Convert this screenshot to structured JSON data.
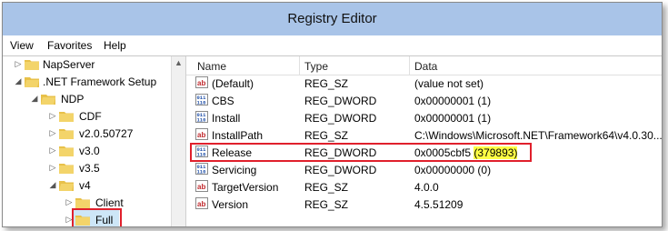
{
  "window": {
    "title": "Registry Editor"
  },
  "menu": [
    "View",
    "Favorites",
    "Help"
  ],
  "tree": [
    {
      "label": "NapServer",
      "expander": "▷"
    },
    {
      "label": ".NET Framework Setup",
      "expander": "◢"
    },
    {
      "label": "NDP",
      "expander": "◢"
    },
    {
      "label": "CDF",
      "expander": "▷"
    },
    {
      "label": "v2.0.50727",
      "expander": "▷"
    },
    {
      "label": "v3.0",
      "expander": "▷"
    },
    {
      "label": "v3.5",
      "expander": "▷"
    },
    {
      "label": "v4",
      "expander": "◢"
    },
    {
      "label": "Client",
      "expander": "▷"
    },
    {
      "label": "Full",
      "expander": "▷"
    }
  ],
  "columns": {
    "name": "Name",
    "type": "Type",
    "data": "Data"
  },
  "values": [
    {
      "icon": "string-value-icon",
      "name": "(Default)",
      "type": "REG_SZ",
      "data": "(value not set)"
    },
    {
      "icon": "binary-value-icon",
      "name": "CBS",
      "type": "REG_DWORD",
      "data": "0x00000001 (1)"
    },
    {
      "icon": "binary-value-icon",
      "name": "Install",
      "type": "REG_DWORD",
      "data": "0x00000001 (1)"
    },
    {
      "icon": "string-value-icon",
      "name": "InstallPath",
      "type": "REG_SZ",
      "data": "C:\\Windows\\Microsoft.NET\\Framework64\\v4.0.30..."
    },
    {
      "icon": "binary-value-icon",
      "name": "Release",
      "type": "REG_DWORD",
      "data": "0x0005cbf5",
      "data_highlight": "(379893)"
    },
    {
      "icon": "binary-value-icon",
      "name": "Servicing",
      "type": "REG_DWORD",
      "data": "0x00000000 (0)"
    },
    {
      "icon": "string-value-icon",
      "name": "TargetVersion",
      "type": "REG_SZ",
      "data": "4.0.0"
    },
    {
      "icon": "string-value-icon",
      "name": "Version",
      "type": "REG_SZ",
      "data": "4.5.51209"
    }
  ],
  "colors": {
    "titlebar": "#a9c4e8",
    "highlight_border": "#e0202c",
    "highlight_fill": "#ffff44",
    "folder": "#e8c14a"
  }
}
